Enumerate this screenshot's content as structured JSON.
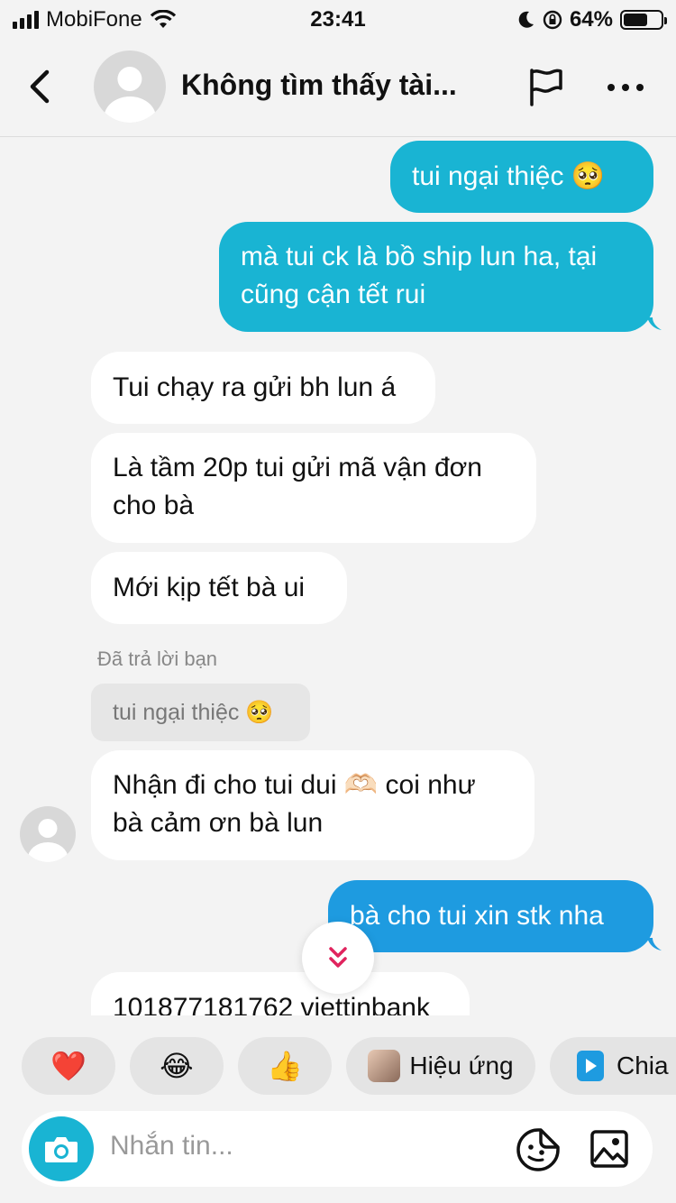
{
  "status": {
    "carrier": "MobiFone",
    "time": "23:41",
    "battery": "64%",
    "battery_level": 0.64
  },
  "header": {
    "title": "Không tìm thấy tài..."
  },
  "messages": [
    {
      "text": "tui ngại thiệc 🥺"
    },
    {
      "text": "mà tui ck là bồ ship lun ha, tại cũng cận tết rui"
    },
    {
      "text": "Tui chạy ra gửi bh lun á"
    },
    {
      "text": "Là tầm 20p tui gửi mã vận đơn cho bà"
    },
    {
      "text": "Mới kịp tết bà ui"
    },
    {
      "text": "Nhận đi cho tui dui 🫶🏻 coi như bà cảm ơn bà lun"
    },
    {
      "text": "bà cho tui xin stk nha"
    },
    {
      "text": "101877181762 viettinbank"
    }
  ],
  "reply": {
    "label": "Đã trả lời bạn",
    "quote": "tui ngại thiệc 🥺"
  },
  "reactions": [
    {
      "icon": "heart-emoji",
      "glyph": "❤️"
    },
    {
      "icon": "laughing-emoji",
      "glyph": "😂"
    },
    {
      "icon": "thumbs-up-emoji",
      "glyph": "👍"
    },
    {
      "label": "Hiệu ứng"
    },
    {
      "label": "Chia s"
    }
  ],
  "input": {
    "placeholder": "Nhắn tin..."
  },
  "colors": {
    "outgoing": "#19b4d3",
    "outgoing_latest": "#1e9be0",
    "incoming": "#ffffff",
    "background": "#f3f3f3",
    "accent_arrow": "#e0245e"
  }
}
